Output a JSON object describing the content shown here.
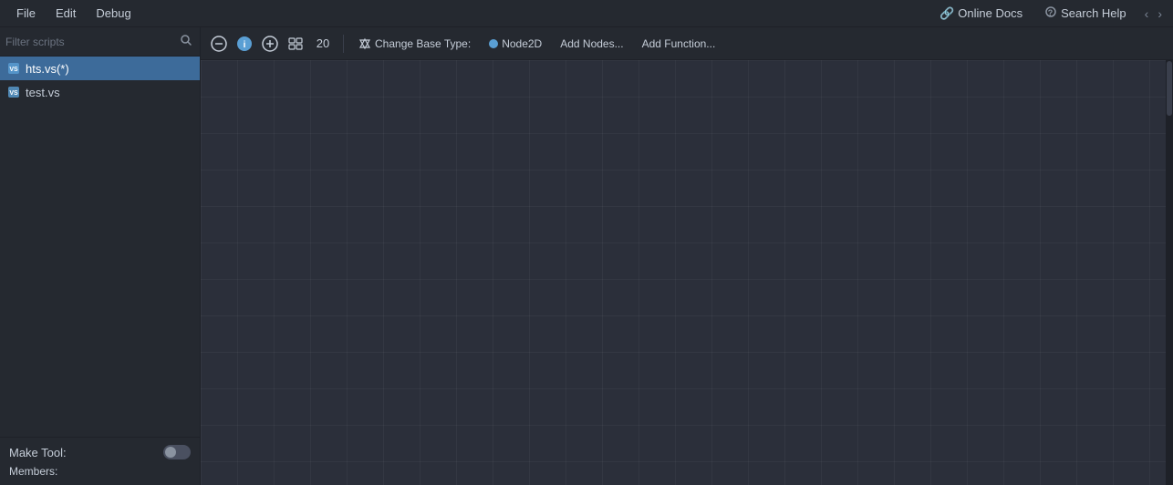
{
  "menubar": {
    "file_label": "File",
    "edit_label": "Edit",
    "debug_label": "Debug",
    "online_docs_label": "Online Docs",
    "search_help_label": "Search Help"
  },
  "sidebar": {
    "filter_placeholder": "Filter scripts",
    "scripts": [
      {
        "name": "hts.vs(*)",
        "active": true
      },
      {
        "name": "test.vs",
        "active": false
      }
    ],
    "make_tool_label": "Make Tool:",
    "members_label": "Members:"
  },
  "toolbar": {
    "zoom_value": "20",
    "change_base_type_label": "Change Base Type:",
    "node2d_label": "Node2D",
    "add_nodes_label": "Add Nodes...",
    "add_function_label": "Add Function..."
  }
}
